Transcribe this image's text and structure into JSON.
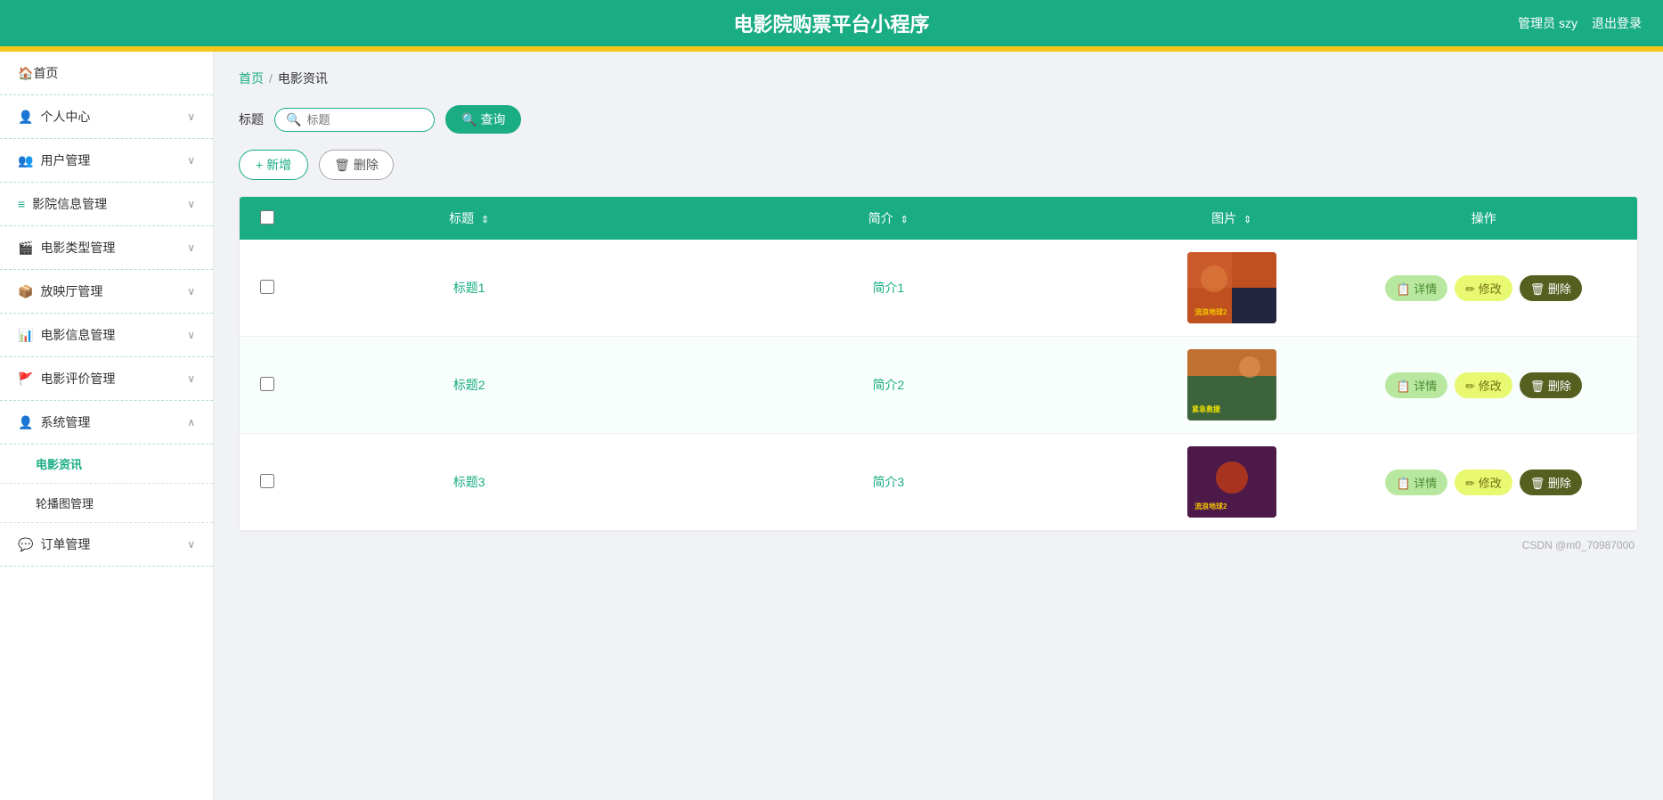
{
  "header": {
    "title": "电影院购票平台小程序",
    "admin_label": "管理员 szy",
    "logout_label": "退出登录"
  },
  "sidebar": {
    "items": [
      {
        "id": "home",
        "icon": "🏠",
        "label": "首页",
        "has_arrow": false,
        "sub": []
      },
      {
        "id": "personal",
        "icon": "👤",
        "label": "个人中心",
        "has_arrow": true,
        "sub": []
      },
      {
        "id": "user-mgmt",
        "icon": "👥",
        "label": "用户管理",
        "has_arrow": true,
        "sub": []
      },
      {
        "id": "cinema-mgmt",
        "icon": "≡",
        "label": "影院信息管理",
        "has_arrow": true,
        "sub": []
      },
      {
        "id": "movie-type",
        "icon": "🎬",
        "label": "电影类型管理",
        "has_arrow": true,
        "sub": []
      },
      {
        "id": "hall-mgmt",
        "icon": "📦",
        "label": "放映厅管理",
        "has_arrow": true,
        "sub": []
      },
      {
        "id": "movie-info",
        "icon": "📊",
        "label": "电影信息管理",
        "has_arrow": true,
        "sub": []
      },
      {
        "id": "movie-review",
        "icon": "🚩",
        "label": "电影评价管理",
        "has_arrow": true,
        "sub": []
      },
      {
        "id": "sys-mgmt",
        "icon": "👤",
        "label": "系统管理",
        "has_arrow": true,
        "expanded": true,
        "sub": [
          {
            "id": "movie-news",
            "label": "电影资讯",
            "active": true
          },
          {
            "id": "banner-mgmt",
            "label": "轮播图管理",
            "active": false
          }
        ]
      },
      {
        "id": "order-mgmt",
        "icon": "💬",
        "label": "订单管理",
        "has_arrow": true,
        "sub": []
      }
    ]
  },
  "breadcrumb": {
    "home": "首页",
    "sep": "/",
    "current": "电影资讯"
  },
  "search": {
    "label": "标题",
    "placeholder": "标题",
    "button_label": "查询"
  },
  "actions": {
    "add_label": "+ 新增",
    "delete_label": "删除"
  },
  "table": {
    "columns": [
      {
        "id": "check",
        "label": ""
      },
      {
        "id": "title",
        "label": "标题",
        "sortable": true
      },
      {
        "id": "desc",
        "label": "简介",
        "sortable": true
      },
      {
        "id": "img",
        "label": "图片",
        "sortable": true
      },
      {
        "id": "op",
        "label": "操作",
        "sortable": false
      }
    ],
    "rows": [
      {
        "id": 1,
        "title": "标题1",
        "desc": "简介1",
        "img_style": "1"
      },
      {
        "id": 2,
        "title": "标题2",
        "desc": "简介2",
        "img_style": "2"
      },
      {
        "id": 3,
        "title": "标题3",
        "desc": "简介3",
        "img_style": "3"
      }
    ],
    "row_actions": {
      "detail": "详情",
      "edit": "修改",
      "delete": "删除"
    }
  },
  "footer": {
    "watermark": "CSDN @m0_70987000"
  }
}
